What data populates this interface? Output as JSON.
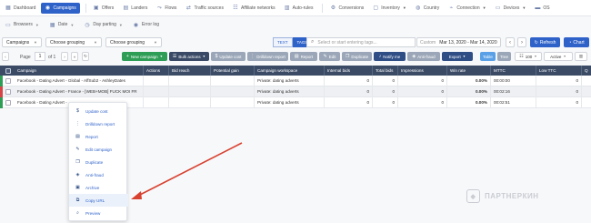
{
  "nav": {
    "items": [
      {
        "label": "Dashboard",
        "icon": "dashboard-icon"
      },
      {
        "label": "Campaigns",
        "icon": "campaigns-icon",
        "active": true
      },
      {
        "label": "Offers",
        "icon": "offers-icon"
      },
      {
        "label": "Landers",
        "icon": "landers-icon"
      },
      {
        "label": "Flows",
        "icon": "flows-icon"
      },
      {
        "label": "Traffic sources",
        "icon": "traffic-sources-icon"
      },
      {
        "label": "Affiliate networks",
        "icon": "affiliate-networks-icon"
      },
      {
        "label": "Auto-rules",
        "icon": "auto-rules-icon"
      },
      {
        "label": "Conversions",
        "icon": "conversions-icon"
      },
      {
        "label": "Inventory",
        "icon": "inventory-icon"
      },
      {
        "label": "Country",
        "icon": "country-icon"
      },
      {
        "label": "Connection",
        "icon": "connection-icon"
      },
      {
        "label": "Devices",
        "icon": "devices-icon"
      },
      {
        "label": "OS",
        "icon": "os-icon"
      }
    ]
  },
  "subnav": {
    "items": [
      {
        "label": "Browsers",
        "icon": "browser-icon",
        "dropdown": true
      },
      {
        "label": "Date",
        "icon": "calendar-icon",
        "dropdown": true
      },
      {
        "label": "Day parting",
        "icon": "clock-icon",
        "dropdown": true
      },
      {
        "label": "Error log",
        "icon": "error-log-icon",
        "dropdown": false
      }
    ]
  },
  "filters": {
    "entity": "Campaigns",
    "grouping1": "Choose grouping",
    "grouping2": "Choose grouping",
    "tag_text": "TEXT",
    "tag_tags": "TAGS",
    "search_placeholder": "Select or start entering tags...",
    "date_label": "Custom",
    "date_value": "Mar 13, 2020 - Mar 14, 2020",
    "refresh_label": "Refresh",
    "chart_label": "Chart"
  },
  "toolbar": {
    "new_campaign": "New campaign",
    "bulk_actions": "Bulk actions",
    "update_cost": "Update cost",
    "update_costs": "Update costs",
    "drilldown_report": "Drilldown report",
    "report": "Report",
    "edit": "Edit",
    "duplicate": "Duplicate",
    "notify_me": "Notify me",
    "anti_fraud": "Anti-fraud",
    "export": "Export",
    "table": "Table",
    "tree": "Tree",
    "page_size": "100",
    "status": "Active"
  },
  "pager": {
    "prefix": "Page",
    "page": "1",
    "of_label": "of 1"
  },
  "table": {
    "headers": [
      "Campaign",
      "Actions",
      "Bid reach",
      "Potential gain",
      "Campaign workspace",
      "Internal bids",
      "Total bids",
      "Impressions",
      "Win rate",
      "MTTC",
      "Low TTC",
      "Q"
    ],
    "rows": [
      {
        "campaign": "Facebook - Dating Advert - Global - AffSub2 - AshleyDates",
        "workspace": "Private: dating adverts",
        "internal_bids": "0",
        "total_bids": "0",
        "impressions": "0",
        "win_rate": "0.00%",
        "mttc": "00:00:00",
        "low_ttc": "0",
        "bar_color": "#2e9e56"
      },
      {
        "campaign": "Facebook - Dating Advert - France - [WEB+MOB] FUCK MOI FR",
        "workspace": "Private: dating adverts",
        "internal_bids": "0",
        "total_bids": "0",
        "impressions": "0",
        "win_rate": "0.00%",
        "mttc": "00:02:16",
        "low_ttc": "0",
        "bar_color": "#d64545"
      },
      {
        "campaign": "Facebook - Dating Advert - ...",
        "workspace": "Private: dating adverts",
        "internal_bids": "0",
        "total_bids": "0",
        "impressions": "0",
        "win_rate": "0.00%",
        "mttc": "00:02:51",
        "low_ttc": "0",
        "bar_color": "#2e9e56"
      }
    ]
  },
  "context_menu": {
    "items": [
      {
        "label": "Update cost",
        "icon": "dollar-icon"
      },
      {
        "label": "Drilldown report",
        "icon": "drilldown-icon"
      },
      {
        "label": "Report",
        "icon": "report-icon"
      },
      {
        "label": "Edit campaign",
        "icon": "edit-icon"
      },
      {
        "label": "Duplicate",
        "icon": "duplicate-icon"
      },
      {
        "label": "Anti-fraud",
        "icon": "shield-icon"
      },
      {
        "label": "Archive",
        "icon": "archive-icon"
      },
      {
        "label": "Copy URL",
        "icon": "copy-icon"
      },
      {
        "label": "Preview",
        "icon": "preview-icon"
      }
    ],
    "hovered_index": 7
  },
  "watermark": {
    "text": "ПАРТНЕРКИН"
  },
  "colors": {
    "accent": "#2f62c9",
    "green": "#2e9e56",
    "header_dark": "#3b4b66",
    "arrow_red": "#d8412f"
  }
}
